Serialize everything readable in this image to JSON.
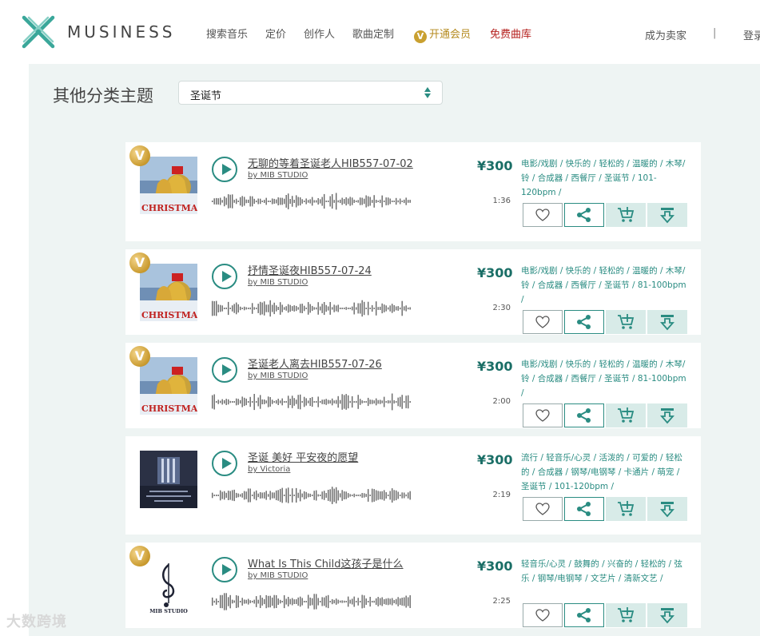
{
  "header": {
    "brand": "MUSINESS",
    "nav": [
      {
        "label": "搜索音乐"
      },
      {
        "label": "定价"
      },
      {
        "label": "创作人"
      },
      {
        "label": "歌曲定制"
      }
    ],
    "vip_label": "开通会员",
    "vip_badge": "V",
    "free_label": "免费曲库",
    "seller_label": "成为卖家",
    "separator": "|",
    "login_label": "登录"
  },
  "filter": {
    "title": "其他分类主题",
    "selected": "圣诞节"
  },
  "colors": {
    "accent": "#2a8c82",
    "price": "#1a6e66",
    "vip": "#c99a2e",
    "free": "#b5201e",
    "band": "#eef4f3"
  },
  "tracks": [
    {
      "vip": "V",
      "cover": "christmas",
      "title": "无聊的等着圣诞老人HIB557-07-02",
      "by": "by MIB STUDIO",
      "price": "¥300",
      "duration": "1:36",
      "tags": "电影/戏剧 / 快乐的 / 轻松的 / 温暖的 / 木琴/铃 / 合成器 / 西餐厅 / 圣诞节 / 101-120bpm /",
      "cover_text": "CHRISTMAS"
    },
    {
      "vip": "V",
      "cover": "christmas",
      "title": "抒情圣诞夜HIB557-07-24",
      "by": "by MIB STUDIO",
      "price": "¥300",
      "duration": "2:30",
      "tags": "电影/戏剧 / 快乐的 / 轻松的 / 温暖的 / 木琴/铃 / 合成器 / 西餐厅 / 圣诞节 / 81-100bpm /",
      "cover_text": "CHRISTMAS"
    },
    {
      "vip": "V",
      "cover": "christmas",
      "title": "圣诞老人离去HIB557-07-26",
      "by": "by MIB STUDIO",
      "price": "¥300",
      "duration": "2:00",
      "tags": "电影/戏剧 / 快乐的 / 轻松的 / 温暖的 / 木琴/铃 / 合成器 / 西餐厅 / 圣诞节 / 81-100bpm /",
      "cover_text": "CHRISTMAS"
    },
    {
      "vip": "",
      "cover": "studio",
      "title": "圣诞 美好 平安夜的愿望",
      "by": "by Victoria",
      "price": "¥300",
      "duration": "2:19",
      "tags": "流行 / 轻音乐/心灵 / 活泼的 / 可爱的 / 轻松的 / 合成器 / 钢琴/电钢琴 / 卡通片 / 萌宠 / 圣诞节 / 101-120bpm /",
      "cover_text": ""
    },
    {
      "vip": "V",
      "cover": "mib",
      "title": "What Is This Child这孩子是什么",
      "by": "by MIB STUDIO",
      "price": "¥300",
      "duration": "2:25",
      "tags": "轻音乐/心灵 / 鼓舞的 / 兴奋的 / 轻松的 / 弦乐 / 钢琴/电钢琴 / 文艺片 / 清新文艺 /",
      "cover_text": "MIB STUDIO"
    }
  ],
  "watermark": "大数跨境"
}
